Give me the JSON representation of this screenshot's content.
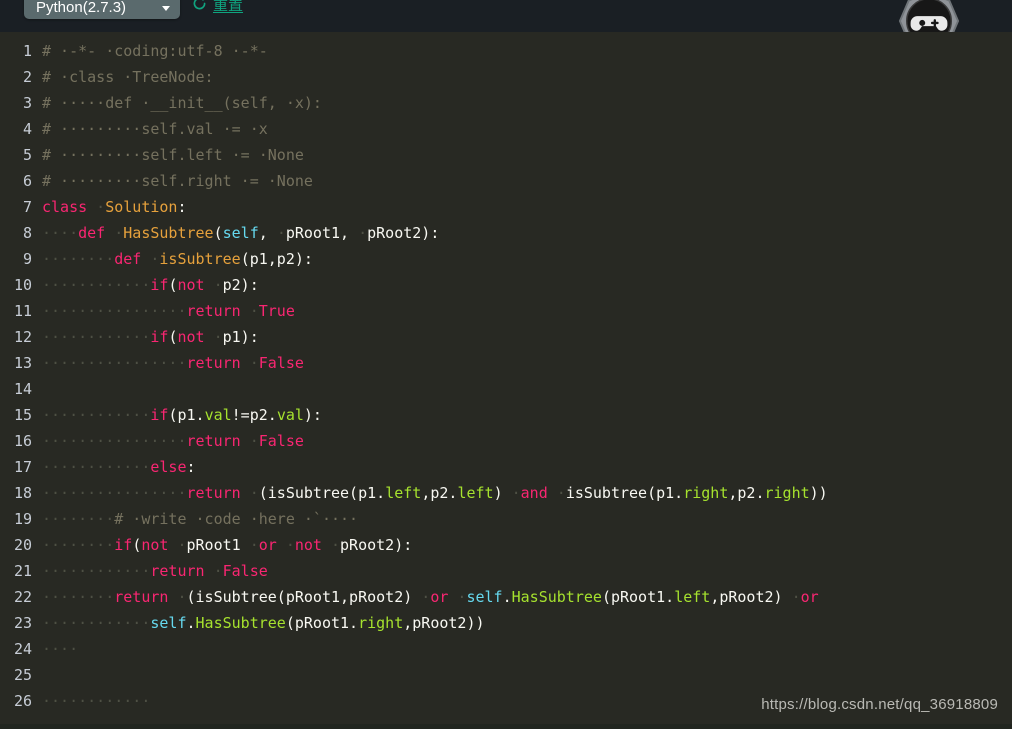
{
  "toolbar": {
    "language_selector": {
      "label": "Python(2.7.3)",
      "icon": "chevron-down-icon"
    },
    "reset": {
      "label": "重置",
      "icon": "refresh-icon",
      "color": "#10a37f"
    },
    "badges": {
      "game_badge_icon": "game-controller-icon",
      "gear_icon": "gear-icon",
      "flag_icon": "flag-icon"
    }
  },
  "editor": {
    "theme": {
      "background": "#282923",
      "header_background": "#1a1f24",
      "line_number_color": "#c7cdd6",
      "comment": "#75715e",
      "keyword": "#f92672",
      "function": "#e6a13c",
      "self": "#66d9ef",
      "plain": "#f8f8f2",
      "attribute": "#a6e22e"
    },
    "lines": [
      {
        "no": "1",
        "tokens": [
          {
            "t": "com",
            "s": "# ·-*- ·coding:utf-8 ·-*-"
          }
        ]
      },
      {
        "no": "2",
        "tokens": [
          {
            "t": "com",
            "s": "# ·class ·TreeNode:"
          }
        ]
      },
      {
        "no": "3",
        "tokens": [
          {
            "t": "com",
            "s": "# ·····def ·__init__(self, ·x):"
          }
        ]
      },
      {
        "no": "4",
        "tokens": [
          {
            "t": "com",
            "s": "# ·········self.val ·= ·x"
          }
        ]
      },
      {
        "no": "5",
        "tokens": [
          {
            "t": "com",
            "s": "# ·········self.left ·= ·None"
          }
        ]
      },
      {
        "no": "6",
        "tokens": [
          {
            "t": "com",
            "s": "# ·········self.right ·= ·None"
          }
        ]
      },
      {
        "no": "7",
        "tokens": [
          {
            "t": "kw",
            "s": "class"
          },
          {
            "t": "ws",
            "s": " ·"
          },
          {
            "t": "fn",
            "s": "Solution"
          },
          {
            "t": "plain",
            "s": ":"
          }
        ]
      },
      {
        "no": "8",
        "tokens": [
          {
            "t": "ws",
            "s": "····"
          },
          {
            "t": "kw",
            "s": "def"
          },
          {
            "t": "ws",
            "s": " ·"
          },
          {
            "t": "fn",
            "s": "HasSubtree"
          },
          {
            "t": "plain",
            "s": "("
          },
          {
            "t": "self",
            "s": "self"
          },
          {
            "t": "plain",
            "s": ", "
          },
          {
            "t": "ws",
            "s": "·"
          },
          {
            "t": "plain",
            "s": "pRoot1, "
          },
          {
            "t": "ws",
            "s": "·"
          },
          {
            "t": "plain",
            "s": "pRoot2):"
          }
        ]
      },
      {
        "no": "9",
        "tokens": [
          {
            "t": "ws",
            "s": "········"
          },
          {
            "t": "kw",
            "s": "def"
          },
          {
            "t": "ws",
            "s": " ·"
          },
          {
            "t": "fn",
            "s": "isSubtree"
          },
          {
            "t": "plain",
            "s": "(p1,p2):"
          }
        ]
      },
      {
        "no": "10",
        "tokens": [
          {
            "t": "ws",
            "s": "············"
          },
          {
            "t": "kw",
            "s": "if"
          },
          {
            "t": "plain",
            "s": "("
          },
          {
            "t": "kw",
            "s": "not"
          },
          {
            "t": "ws",
            "s": " ·"
          },
          {
            "t": "plain",
            "s": "p2):"
          }
        ]
      },
      {
        "no": "11",
        "tokens": [
          {
            "t": "ws",
            "s": "················"
          },
          {
            "t": "kw",
            "s": "return"
          },
          {
            "t": "ws",
            "s": " ·"
          },
          {
            "t": "kw",
            "s": "True"
          }
        ]
      },
      {
        "no": "12",
        "tokens": [
          {
            "t": "ws",
            "s": "············"
          },
          {
            "t": "kw",
            "s": "if"
          },
          {
            "t": "plain",
            "s": "("
          },
          {
            "t": "kw",
            "s": "not"
          },
          {
            "t": "ws",
            "s": " ·"
          },
          {
            "t": "plain",
            "s": "p1):"
          }
        ]
      },
      {
        "no": "13",
        "tokens": [
          {
            "t": "ws",
            "s": "················"
          },
          {
            "t": "kw",
            "s": "return"
          },
          {
            "t": "ws",
            "s": " ·"
          },
          {
            "t": "kw",
            "s": "False"
          }
        ]
      },
      {
        "no": "14",
        "tokens": []
      },
      {
        "no": "15",
        "tokens": [
          {
            "t": "ws",
            "s": "············"
          },
          {
            "t": "kw",
            "s": "if"
          },
          {
            "t": "plain",
            "s": "(p1."
          },
          {
            "t": "attr",
            "s": "val"
          },
          {
            "t": "plain",
            "s": "!=p2."
          },
          {
            "t": "attr",
            "s": "val"
          },
          {
            "t": "plain",
            "s": "):"
          }
        ]
      },
      {
        "no": "16",
        "tokens": [
          {
            "t": "ws",
            "s": "················"
          },
          {
            "t": "kw",
            "s": "return"
          },
          {
            "t": "ws",
            "s": " ·"
          },
          {
            "t": "kw",
            "s": "False"
          }
        ]
      },
      {
        "no": "17",
        "tokens": [
          {
            "t": "ws",
            "s": "············"
          },
          {
            "t": "kw",
            "s": "else"
          },
          {
            "t": "plain",
            "s": ":"
          }
        ]
      },
      {
        "no": "18",
        "tokens": [
          {
            "t": "ws",
            "s": "················"
          },
          {
            "t": "kw",
            "s": "return"
          },
          {
            "t": "ws",
            "s": " ·"
          },
          {
            "t": "plain",
            "s": "(isSubtree(p1."
          },
          {
            "t": "attr",
            "s": "left"
          },
          {
            "t": "plain",
            "s": ",p2."
          },
          {
            "t": "attr",
            "s": "left"
          },
          {
            "t": "plain",
            "s": ")"
          },
          {
            "t": "ws",
            "s": " ·"
          },
          {
            "t": "kw",
            "s": "and"
          },
          {
            "t": "ws",
            "s": " ·"
          },
          {
            "t": "plain",
            "s": "isSubtree(p1."
          },
          {
            "t": "attr",
            "s": "right"
          },
          {
            "t": "plain",
            "s": ",p2."
          },
          {
            "t": "attr",
            "s": "right"
          },
          {
            "t": "plain",
            "s": "))"
          }
        ]
      },
      {
        "no": "19",
        "tokens": [
          {
            "t": "ws",
            "s": "········"
          },
          {
            "t": "com",
            "s": "# ·write ·code ·here ·`····"
          }
        ]
      },
      {
        "no": "20",
        "tokens": [
          {
            "t": "ws",
            "s": "········"
          },
          {
            "t": "kw",
            "s": "if"
          },
          {
            "t": "plain",
            "s": "("
          },
          {
            "t": "kw",
            "s": "not"
          },
          {
            "t": "ws",
            "s": " ·"
          },
          {
            "t": "plain",
            "s": "pRoot1"
          },
          {
            "t": "ws",
            "s": " ·"
          },
          {
            "t": "kw",
            "s": "or"
          },
          {
            "t": "ws",
            "s": " ·"
          },
          {
            "t": "kw",
            "s": "not"
          },
          {
            "t": "ws",
            "s": " ·"
          },
          {
            "t": "plain",
            "s": "pRoot2):"
          }
        ]
      },
      {
        "no": "21",
        "tokens": [
          {
            "t": "ws",
            "s": "············"
          },
          {
            "t": "kw",
            "s": "return"
          },
          {
            "t": "ws",
            "s": " ·"
          },
          {
            "t": "kw",
            "s": "False"
          }
        ]
      },
      {
        "no": "22",
        "tokens": [
          {
            "t": "ws",
            "s": "········"
          },
          {
            "t": "kw",
            "s": "return"
          },
          {
            "t": "ws",
            "s": " ·"
          },
          {
            "t": "plain",
            "s": "(isSubtree(pRoot1,pRoot2)"
          },
          {
            "t": "ws",
            "s": " ·"
          },
          {
            "t": "kw",
            "s": "or"
          },
          {
            "t": "ws",
            "s": " ·"
          },
          {
            "t": "self",
            "s": "self"
          },
          {
            "t": "plain",
            "s": "."
          },
          {
            "t": "attr",
            "s": "HasSubtree"
          },
          {
            "t": "plain",
            "s": "(pRoot1."
          },
          {
            "t": "attr",
            "s": "left"
          },
          {
            "t": "plain",
            "s": ",pRoot2)"
          },
          {
            "t": "ws",
            "s": " ·"
          },
          {
            "t": "kw",
            "s": "or"
          }
        ]
      },
      {
        "no": "23",
        "tokens": [
          {
            "t": "ws",
            "s": "············"
          },
          {
            "t": "self",
            "s": "self"
          },
          {
            "t": "plain",
            "s": "."
          },
          {
            "t": "attr",
            "s": "HasSubtree"
          },
          {
            "t": "plain",
            "s": "(pRoot1."
          },
          {
            "t": "attr",
            "s": "right"
          },
          {
            "t": "plain",
            "s": ",pRoot2))"
          }
        ]
      },
      {
        "no": "24",
        "tokens": [
          {
            "t": "ws",
            "s": "····"
          }
        ]
      },
      {
        "no": "25",
        "tokens": []
      },
      {
        "no": "26",
        "tokens": [
          {
            "t": "ws",
            "s": "············"
          }
        ]
      }
    ]
  },
  "watermark": {
    "text": "https://blog.csdn.net/qq_36918809"
  }
}
